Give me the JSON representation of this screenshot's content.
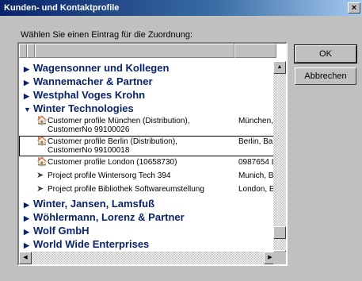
{
  "window": {
    "title": "Kunden- und Kontaktprofile",
    "close_label": "×"
  },
  "instruction": "Wählen Sie einen Eintrag für die Zuordnung:",
  "buttons": {
    "ok": "OK",
    "cancel": "Abbrechen"
  },
  "list": {
    "groups_before": [
      {
        "label": "Wagensonner und Kollegen"
      },
      {
        "label": "Wannemacher & Partner"
      },
      {
        "label": "Westphal Voges Krohn"
      }
    ],
    "expanded_group": {
      "label": "Winter Technologies"
    },
    "items": [
      {
        "line1": "Customer profile München (Distribution),",
        "line2": "CustomerNo 99100026",
        "location": "München,",
        "icon": "customer-profile-icon"
      },
      {
        "line1": "Customer profile Berlin (Distribution),",
        "line2": "CustomerNo 99100018",
        "location": "Berlin, Bal",
        "icon": "customer-profile-icon"
      },
      {
        "line1": "Customer profile London (10658730)",
        "line2": "",
        "location": "0987654 L",
        "icon": "customer-profile-icon"
      },
      {
        "line1": "Project profile Wintersorg Tech 394",
        "line2": "",
        "location": "Munich, B",
        "icon": "project-profile-icon"
      },
      {
        "line1": "Project profile Bibliothek Softwareumstellung",
        "line2": "",
        "location": "London, E",
        "icon": "project-profile-icon"
      }
    ],
    "groups_after": [
      {
        "label": "Winter, Jansen, Lamsfuß"
      },
      {
        "label": "Wöhlermann, Lorenz & Partner"
      },
      {
        "label": "Wolf GmbH"
      },
      {
        "label": "World Wide Enterprises"
      }
    ]
  }
}
